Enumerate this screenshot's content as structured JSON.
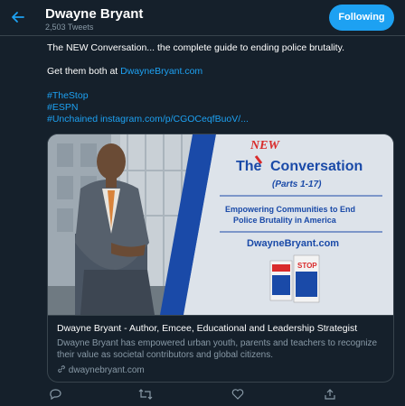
{
  "header": {
    "back_icon": "back-arrow-icon",
    "name": "Dwayne Bryant",
    "tweet_count": "2,503 Tweets",
    "follow_label": "Following"
  },
  "tweet": {
    "line1": "The NEW Conversation... the complete guide to ending police brutality.",
    "line2_prefix": "Get them both at ",
    "line2_link": "DwayneBryant.com",
    "hashtag1": "#TheStop",
    "hashtag2": "#ESPN",
    "hashtag3": "#Unchained instagram.com/p/CGOCeqfBuoV/..."
  },
  "card": {
    "promo": {
      "the": "The",
      "new": "NEW",
      "conversation": "Conversation",
      "parts": "(Parts 1-17)",
      "sub1": "Empowering Communities to End",
      "sub2": "Police Brutality in America",
      "site": "DwayneBryant.com",
      "book_title": "STOP"
    },
    "title": "Dwayne Bryant - Author, Emcee, Educational and Leadership Strategist",
    "description": "Dwayne Bryant has empowered urban youth, parents and teachers to recognize their value as societal contributors and global citizens.",
    "domain": "dwaynebryant.com"
  },
  "actions": {
    "reply_icon": "reply-icon",
    "retweet_icon": "retweet-icon",
    "like_icon": "heart-icon",
    "share_icon": "share-icon"
  },
  "colors": {
    "background": "#15202b",
    "accent": "#1da1f2",
    "muted": "#8899a6",
    "border": "#38444d",
    "promo_blue": "#1a4aa8",
    "promo_red": "#d92b2b"
  }
}
